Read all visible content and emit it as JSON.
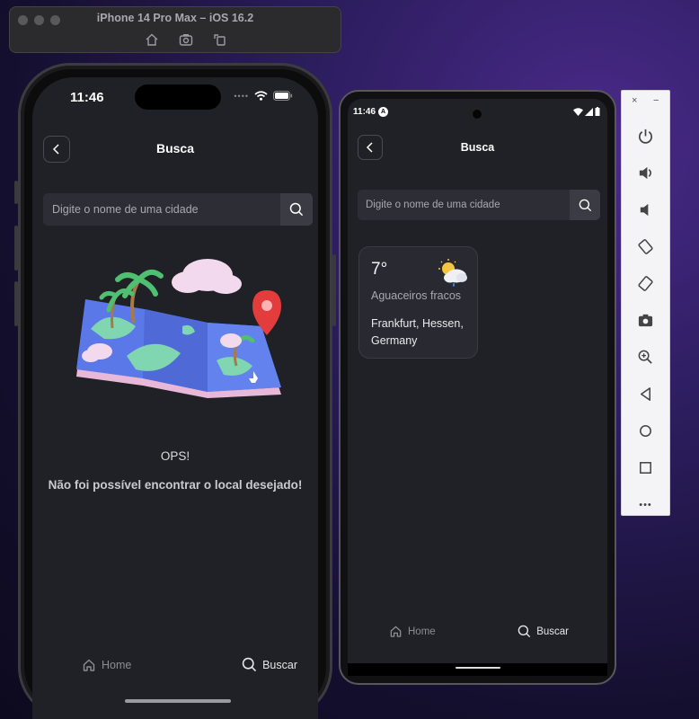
{
  "simulator": {
    "title": "iPhone 14 Pro Max – iOS 16.2",
    "tools": [
      "home-icon",
      "screenshot-icon",
      "rotate-icon"
    ]
  },
  "ios": {
    "time": "11:46",
    "header_title": "Busca",
    "search_placeholder": "Digite o nome de uma cidade",
    "ops_title": "OPS!",
    "ops_message": "Não foi possível encontrar o local desejado!",
    "tabs": [
      {
        "label": "Home",
        "icon": "home-icon",
        "active": false
      },
      {
        "label": "Buscar",
        "icon": "search-icon",
        "active": true
      }
    ]
  },
  "android": {
    "time": "11:46",
    "status_badge": "A",
    "header_title": "Busca",
    "search_placeholder": "Digite o nome de uma cidade",
    "weather_card": {
      "temperature": "7°",
      "description": "Aguaceiros fracos",
      "location": "Frankfurt, Hessen, Germany",
      "icon": "partly-cloudy-rain-icon"
    },
    "tabs": [
      {
        "label": "Home",
        "icon": "home-icon",
        "active": false
      },
      {
        "label": "Buscar",
        "icon": "search-icon",
        "active": true
      }
    ]
  },
  "emulator_panel": {
    "close": "×",
    "minimize": "−",
    "tools": [
      "power-icon",
      "volume-up-icon",
      "volume-down-icon",
      "rotate-left-icon",
      "rotate-right-icon",
      "camera-icon",
      "zoom-icon",
      "back-icon",
      "home-circle-icon",
      "overview-icon",
      "more-icon"
    ],
    "more": "•••"
  },
  "colors": {
    "app_bg": "#202126",
    "input_bg": "#2d2e35",
    "card_bg": "#292a31",
    "map_blue": "#5b78e8",
    "pin_red": "#e23c3c"
  }
}
